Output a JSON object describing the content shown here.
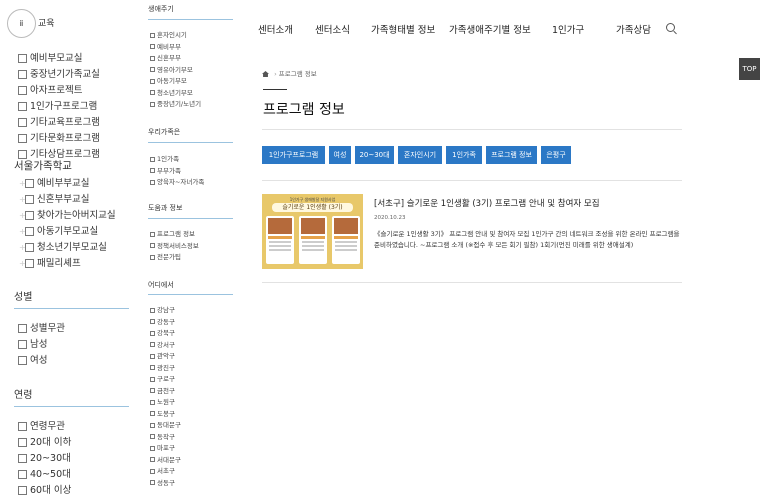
{
  "left": {
    "logo": "ⅱ",
    "logo_tail": "교육",
    "group1": [
      "예비부모교실",
      "중장년기가족교실",
      "아자프로젝트",
      "1인가구프로그램",
      "기타교육프로그램",
      "기타문화프로그램",
      "기타상담프로그램"
    ],
    "seoul_heading": "서울가족학교",
    "seoul_items": [
      "예비부부교실",
      "신혼부부교실",
      "찾아가는아버지교실",
      "아동기부모교실",
      "청소년기부모교실",
      "패밀리셰프"
    ],
    "gender_heading": "성별",
    "gender_items": [
      "성별무관",
      "남성",
      "여성"
    ],
    "age_heading": "연령",
    "age_items": [
      "연령무관",
      "20대 이하",
      "20~30대",
      "40~50대",
      "60대 이상"
    ]
  },
  "mid": {
    "lifecycle_heading": "생애주기",
    "lifecycle_items": [
      "혼자인시기",
      "예비부부",
      "신혼부부",
      "영유아기부모",
      "아동기부모",
      "청소년기부모",
      "중장년기/노년기"
    ],
    "family_heading": "우리가족은",
    "family_items": [
      "1인가족",
      "부부가족",
      "양육자~자녀가족"
    ],
    "help_heading": "도움과 정보",
    "help_items": [
      "프로그램 정보",
      "정책서비스정보",
      "전문가팁"
    ],
    "where_heading": "어디에서",
    "where_items": [
      "강남구",
      "강동구",
      "강북구",
      "강서구",
      "관악구",
      "광진구",
      "구로구",
      "금천구",
      "노원구",
      "도봉구",
      "동대문구",
      "동작구",
      "마포구",
      "서대문구",
      "서초구",
      "성동구"
    ]
  },
  "nav": {
    "items": [
      "센터소개",
      "센터소식",
      "가족형태별 정보",
      "가족생애주기별 정보",
      "1인가구",
      "가족상담"
    ],
    "top_label": "TOP"
  },
  "main": {
    "breadcrumb": "프로그램 정보",
    "title": "프로그램 정보",
    "tags": [
      "1인가구프로그램",
      "여성",
      "20~30대",
      "혼자인시기",
      "1인가족",
      "프로그램 정보",
      "은평구"
    ],
    "post": {
      "thumb_small": "1인가구 생애발달 지원사업",
      "thumb_title": "슬기로운 1인생활 (3기)",
      "title": "[서초구] 슬기로운 1인생활 (3기) 프로그램 안내 및 참여자 모집",
      "date": "2020.10.23",
      "desc": "《슬기로운 1인생활 3기》 프로그램 안내 및 참여자 모집    1인가구 간의 네트워크 조성을 위한 온라인 프로그램을 준비하였습니다.  ~프로그램 소개 (※접수 후 모든 회기 필참)  1회기(먼진 미래를 위한 생애설계)"
    }
  }
}
